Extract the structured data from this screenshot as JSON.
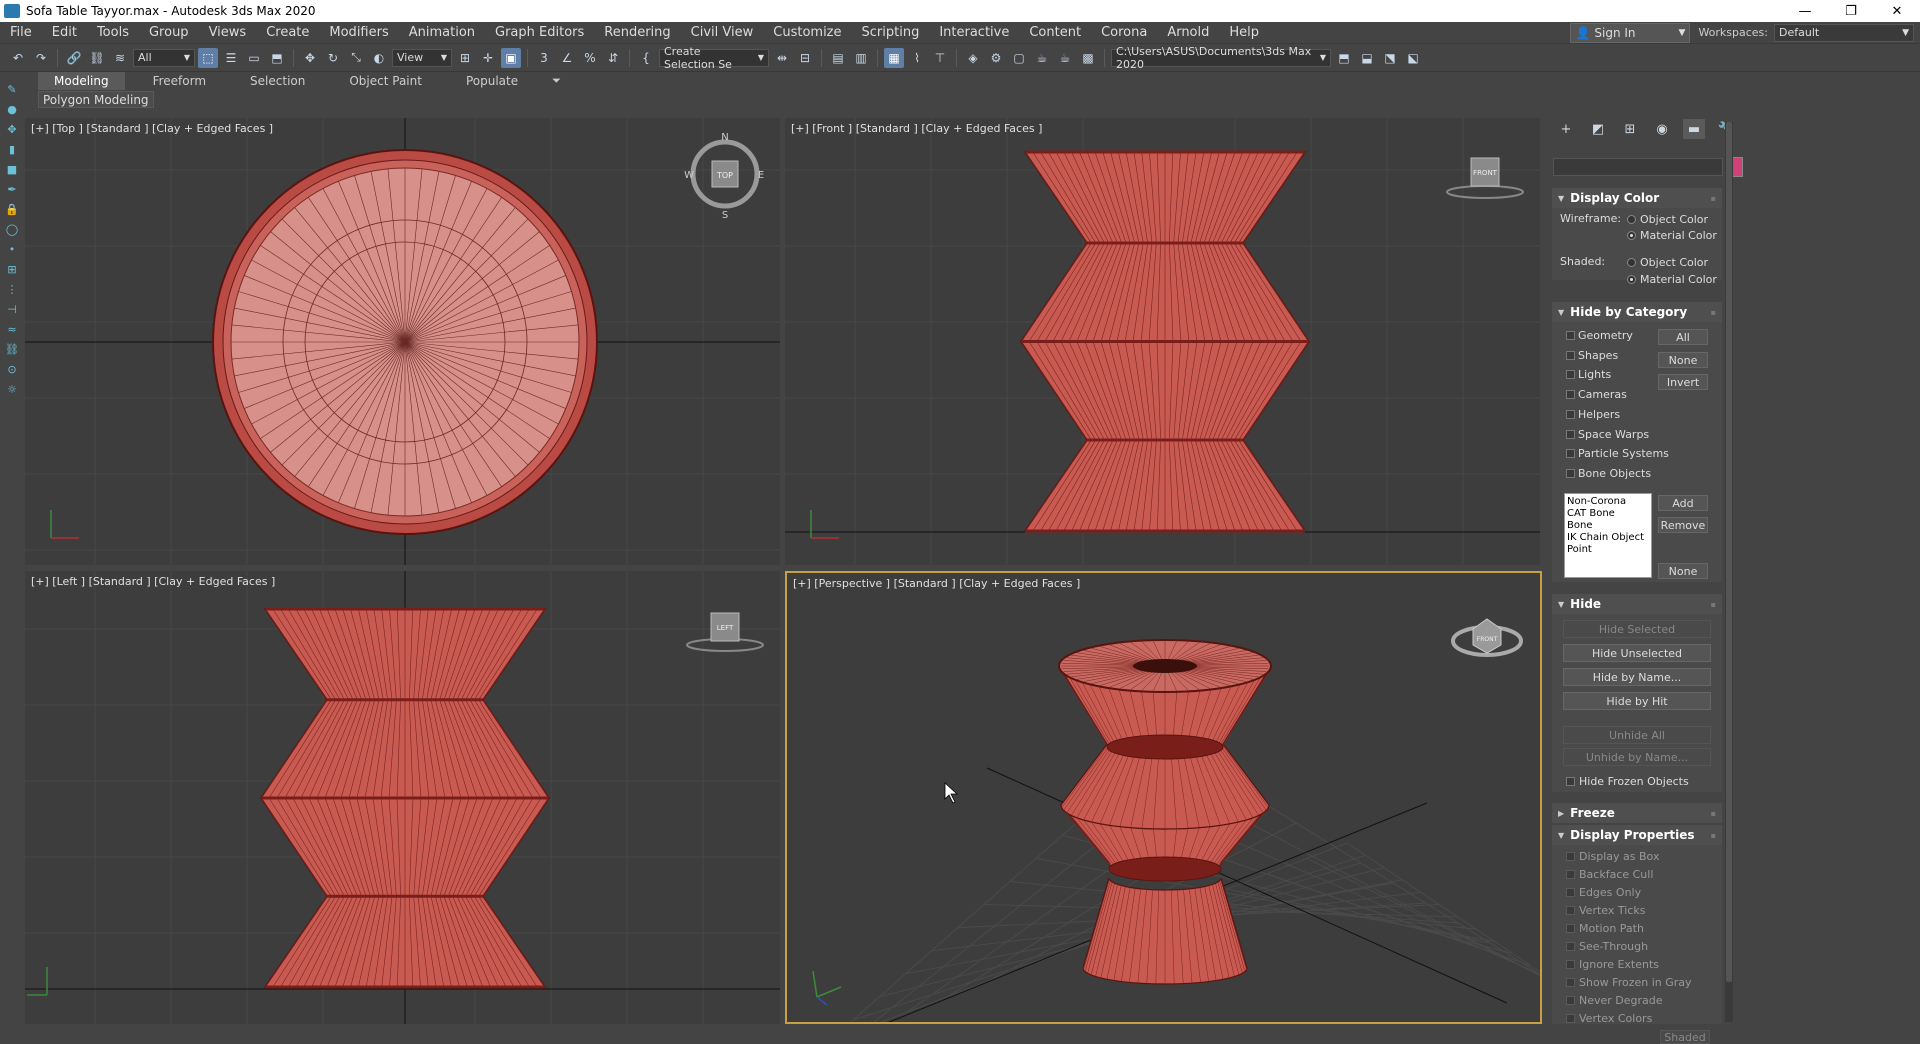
{
  "window": {
    "title": "Sofa Table Tayyor.max - Autodesk 3ds Max 2020",
    "minimize_glyph": "—",
    "maximize_glyph": "❐",
    "close_glyph": "✕"
  },
  "menubar": {
    "items": [
      "File",
      "Edit",
      "Tools",
      "Group",
      "Views",
      "Create",
      "Modifiers",
      "Animation",
      "Graph Editors",
      "Rendering",
      "Civil View",
      "Customize",
      "Scripting",
      "Interactive",
      "Content",
      "Corona",
      "Arnold",
      "Help"
    ],
    "sign_in": "Sign In",
    "workspaces_label": "Workspaces:",
    "workspaces_value": "Default"
  },
  "toolbar": {
    "selection_filter": "All",
    "reference_coord": "View",
    "named_selection": "Create Selection Se",
    "project_path": "C:\\Users\\ASUS\\Documents\\3ds Max 2020"
  },
  "ribbon": {
    "tabs": [
      "Modeling",
      "Freeform",
      "Selection",
      "Object Paint",
      "Populate"
    ],
    "selected_tab": "Modeling",
    "panel_label": "Polygon Modeling"
  },
  "viewports": {
    "top": {
      "label": "[+] [Top ] [Standard ] [Clay + Edged Faces ]",
      "viewcube": "TOP",
      "compass": {
        "n": "N",
        "s": "S",
        "e": "E",
        "w": "W"
      }
    },
    "front": {
      "label": "[+] [Front ] [Standard ] [Clay + Edged Faces ]",
      "viewcube": "FRONT"
    },
    "left": {
      "label": "[+] [Left ] [Standard ] [Clay + Edged Faces ]",
      "viewcube": "LEFT"
    },
    "perspective": {
      "label": "[+] [Perspective ] [Standard ] [Clay + Edged Faces ]",
      "viewcube": "FRONT"
    }
  },
  "colors": {
    "object_fill": "#c85a52",
    "object_dark": "#7a1e1a",
    "object_edge": "#5a1410",
    "active_viewport_border": "#c6a243",
    "object_color_swatch": "#d0417a"
  },
  "command_panel": {
    "display_color": {
      "title": "Display Color",
      "wireframe_label": "Wireframe:",
      "shaded_label": "Shaded:",
      "object_color": "Object Color",
      "material_color": "Material Color"
    },
    "hide_by_category": {
      "title": "Hide by Category",
      "categories": [
        "Geometry",
        "Shapes",
        "Lights",
        "Cameras",
        "Helpers",
        "Space Warps",
        "Particle Systems",
        "Bone Objects"
      ],
      "all_btn": "All",
      "none_btn": "None",
      "invert_btn": "Invert",
      "list": [
        "Non-Corona",
        "CAT Bone",
        "Bone",
        "IK Chain Object",
        "Point"
      ],
      "add_btn": "Add",
      "remove_btn": "Remove",
      "none_btn2": "None"
    },
    "hide": {
      "title": "Hide",
      "hide_selected": "Hide Selected",
      "hide_unselected": "Hide Unselected",
      "hide_by_name": "Hide by Name...",
      "hide_by_hit": "Hide by Hit",
      "unhide_all": "Unhide All",
      "unhide_by_name": "Unhide by Name...",
      "hide_frozen": "Hide Frozen Objects"
    },
    "freeze": {
      "title": "Freeze"
    },
    "display_properties": {
      "title": "Display Properties",
      "items": [
        "Display as Box",
        "Backface Cull",
        "Edges Only",
        "Vertex Ticks",
        "Motion Path",
        "See-Through",
        "Ignore Extents",
        "Show Frozen in Gray",
        "Never Degrade",
        "Vertex Colors"
      ],
      "shaded_btn": "Shaded"
    }
  }
}
